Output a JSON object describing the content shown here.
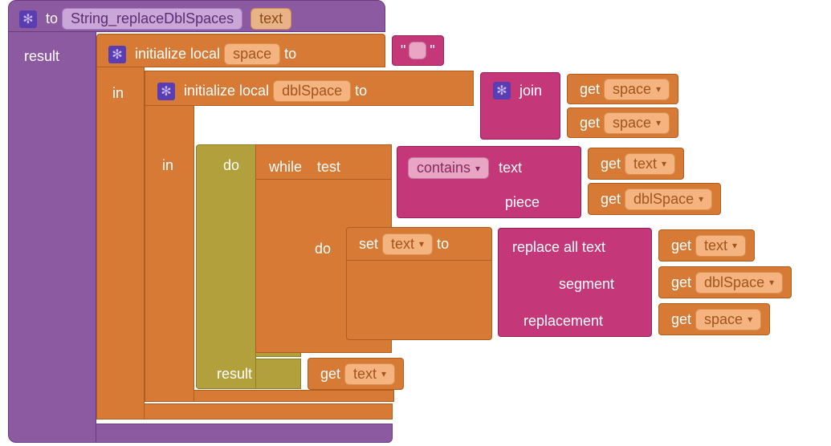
{
  "proc": {
    "to": "to",
    "name": "String_replaceDblSpaces",
    "param": "text",
    "result_label": "result"
  },
  "local1": {
    "init": "initialize local",
    "var": "space",
    "to": "to",
    "in": "in",
    "literal_left": "\"",
    "literal_val": " ",
    "literal_right": "\""
  },
  "local2": {
    "init": "initialize local",
    "var": "dblSpace",
    "to": "to",
    "in": "in"
  },
  "join": {
    "label": "join",
    "get": "get",
    "arg": "space"
  },
  "doresult": {
    "do": "do",
    "result": "result"
  },
  "while": {
    "while": "while",
    "test": "test",
    "do": "do"
  },
  "contains": {
    "op": "contains",
    "text_lbl": "text",
    "piece_lbl": "piece"
  },
  "getters": {
    "get": "get",
    "text": "text",
    "dblSpace": "dblSpace",
    "space": "space"
  },
  "set": {
    "set": "set",
    "var": "text",
    "to": "to"
  },
  "replace": {
    "lbl": "replace all text",
    "segment": "segment",
    "replacement": "replacement"
  }
}
